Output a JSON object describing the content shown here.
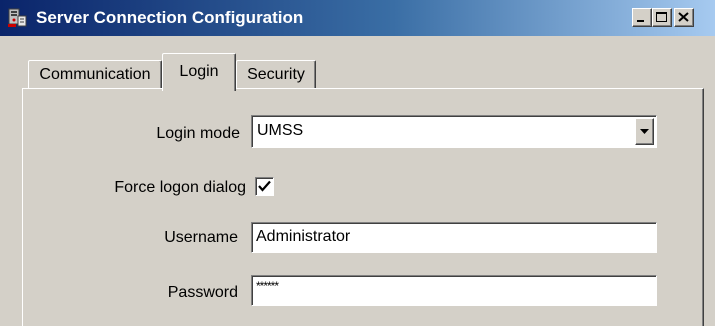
{
  "window": {
    "title": "Server Connection Configuration",
    "icon": "server-connection-icon",
    "controls": [
      "minimize-icon",
      "maximize-icon",
      "close-icon"
    ]
  },
  "tabs": [
    {
      "label": "Communication",
      "selected": false
    },
    {
      "label": "Login",
      "selected": true
    },
    {
      "label": "Security",
      "selected": false
    }
  ],
  "login": {
    "login_mode_label": "Login mode",
    "login_mode_value": "UMSS",
    "force_logon_label": "Force logon dialog",
    "force_logon_checked": true,
    "username_label": "Username",
    "username_value": "Administrator",
    "password_label": "Password",
    "password_value": "******"
  },
  "colors": {
    "titlebar_start": "#0a246a",
    "titlebar_end": "#a6caf0",
    "face": "#d4d0c8",
    "title_text": "#ffffff"
  }
}
